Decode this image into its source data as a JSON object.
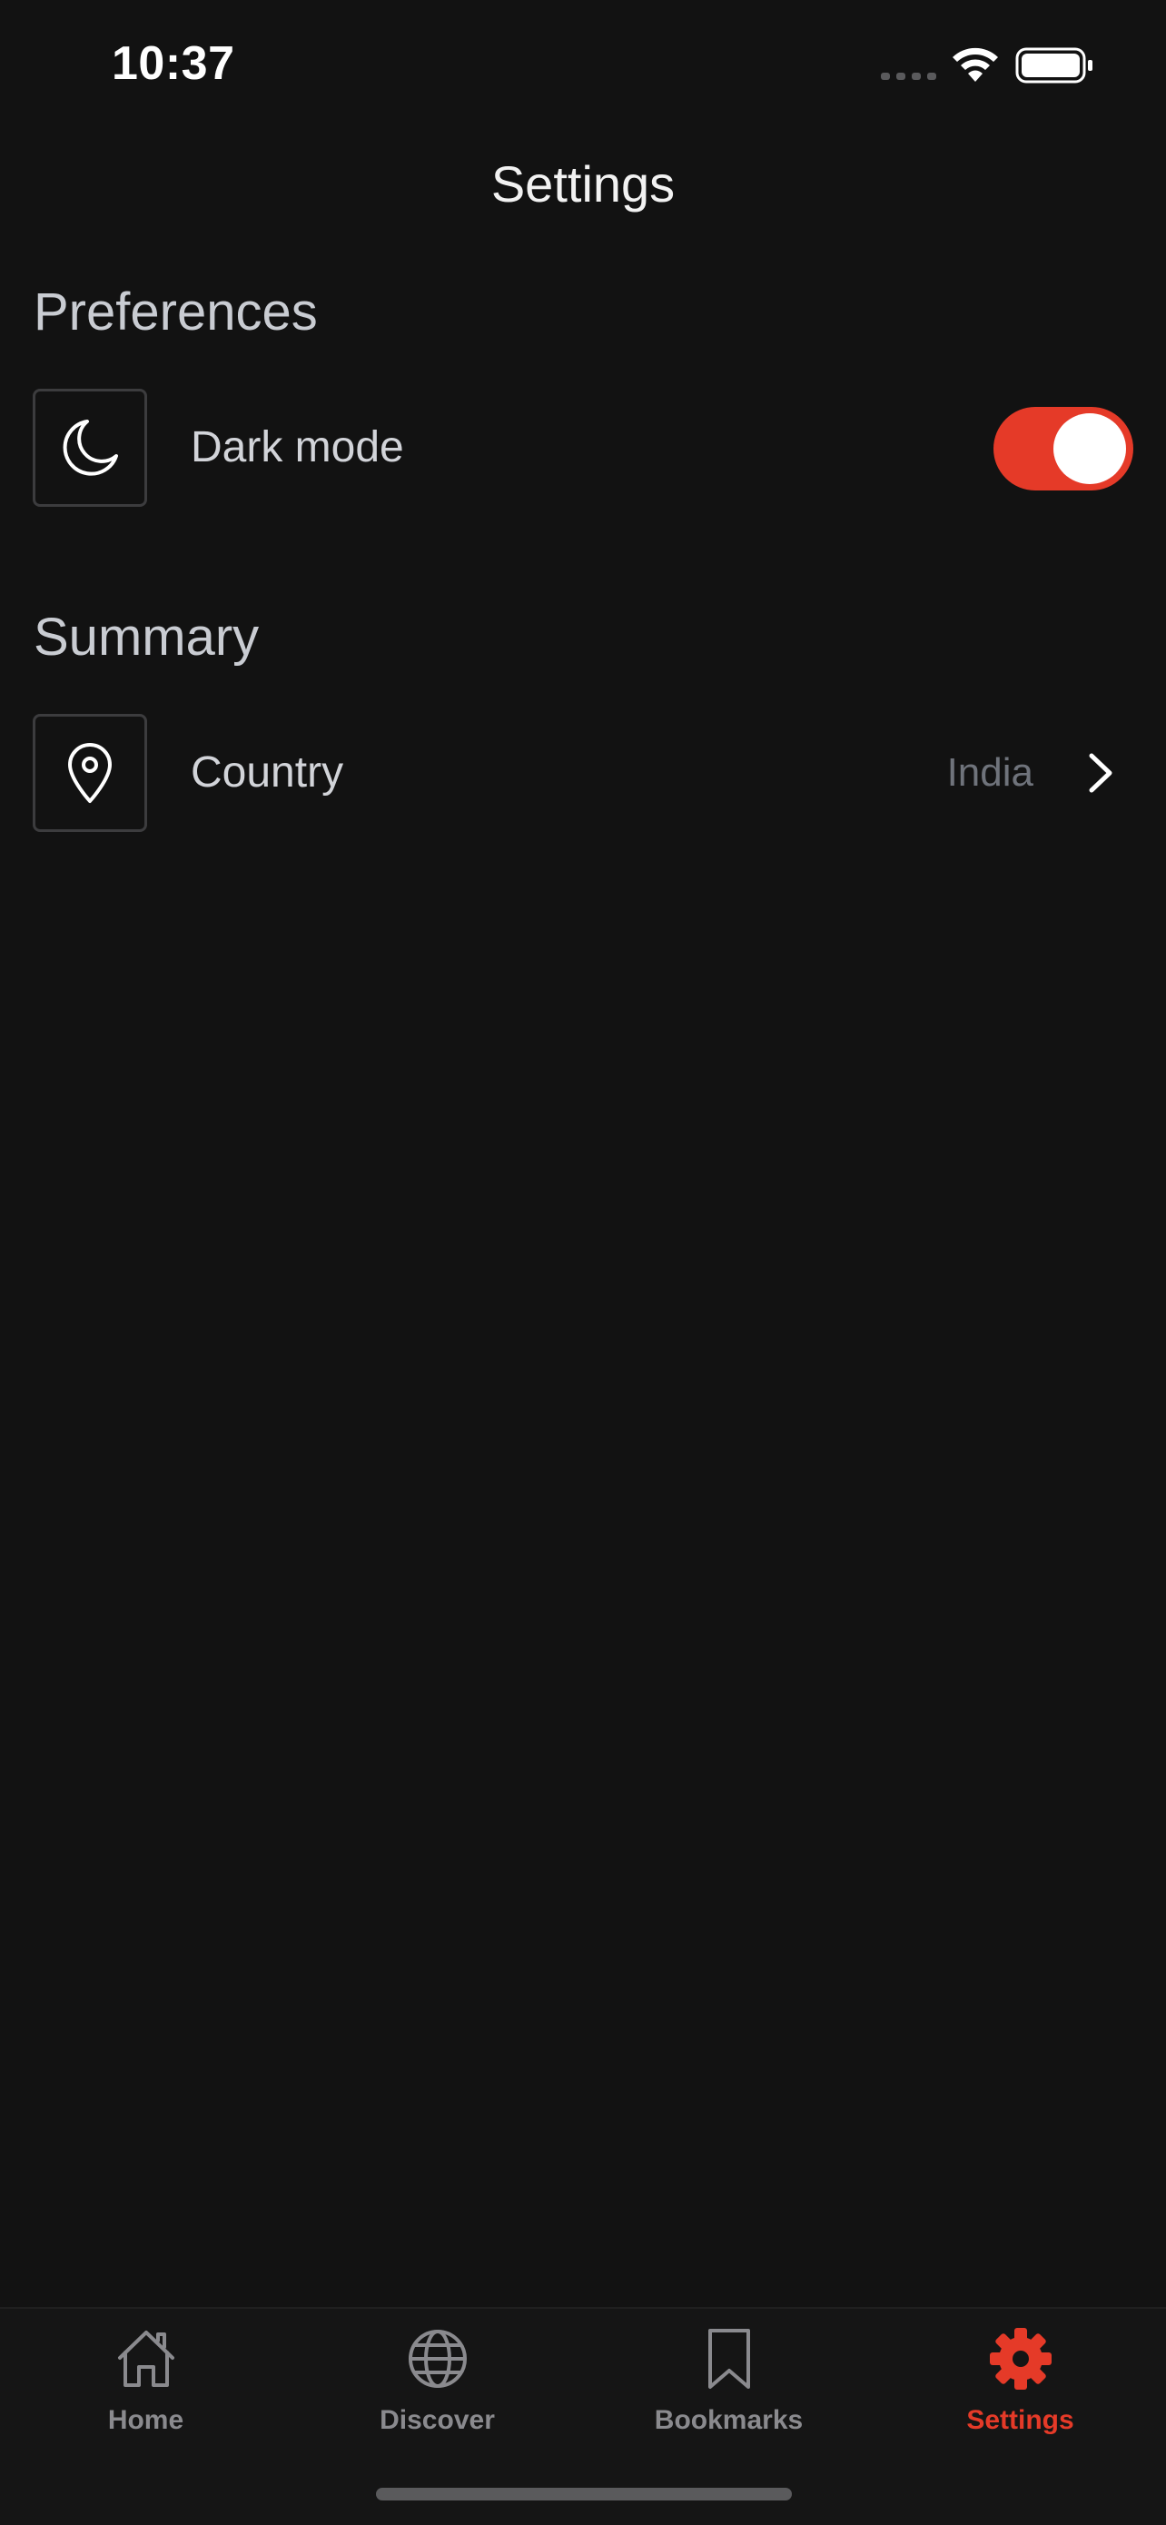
{
  "status_bar": {
    "time": "10:37"
  },
  "header": {
    "title": "Settings"
  },
  "sections": {
    "preferences": {
      "title": "Preferences",
      "dark_mode": {
        "label": "Dark mode",
        "icon": "moon-icon",
        "enabled": true
      }
    },
    "summary": {
      "title": "Summary",
      "country": {
        "label": "Country",
        "value": "India",
        "icon": "location-pin-icon"
      }
    }
  },
  "tab_bar": {
    "tabs": [
      {
        "label": "Home",
        "icon": "home-icon",
        "active": false
      },
      {
        "label": "Discover",
        "icon": "globe-icon",
        "active": false
      },
      {
        "label": "Bookmarks",
        "icon": "bookmark-icon",
        "active": false
      },
      {
        "label": "Settings",
        "icon": "gear-icon",
        "active": true
      }
    ]
  },
  "colors": {
    "background": "#121212",
    "accent": "#e53a28",
    "inactive_tab": "#8a8a8e",
    "section_title": "#c9ccd2",
    "row_label": "#d2d4d9",
    "secondary_value": "#6f737b"
  }
}
